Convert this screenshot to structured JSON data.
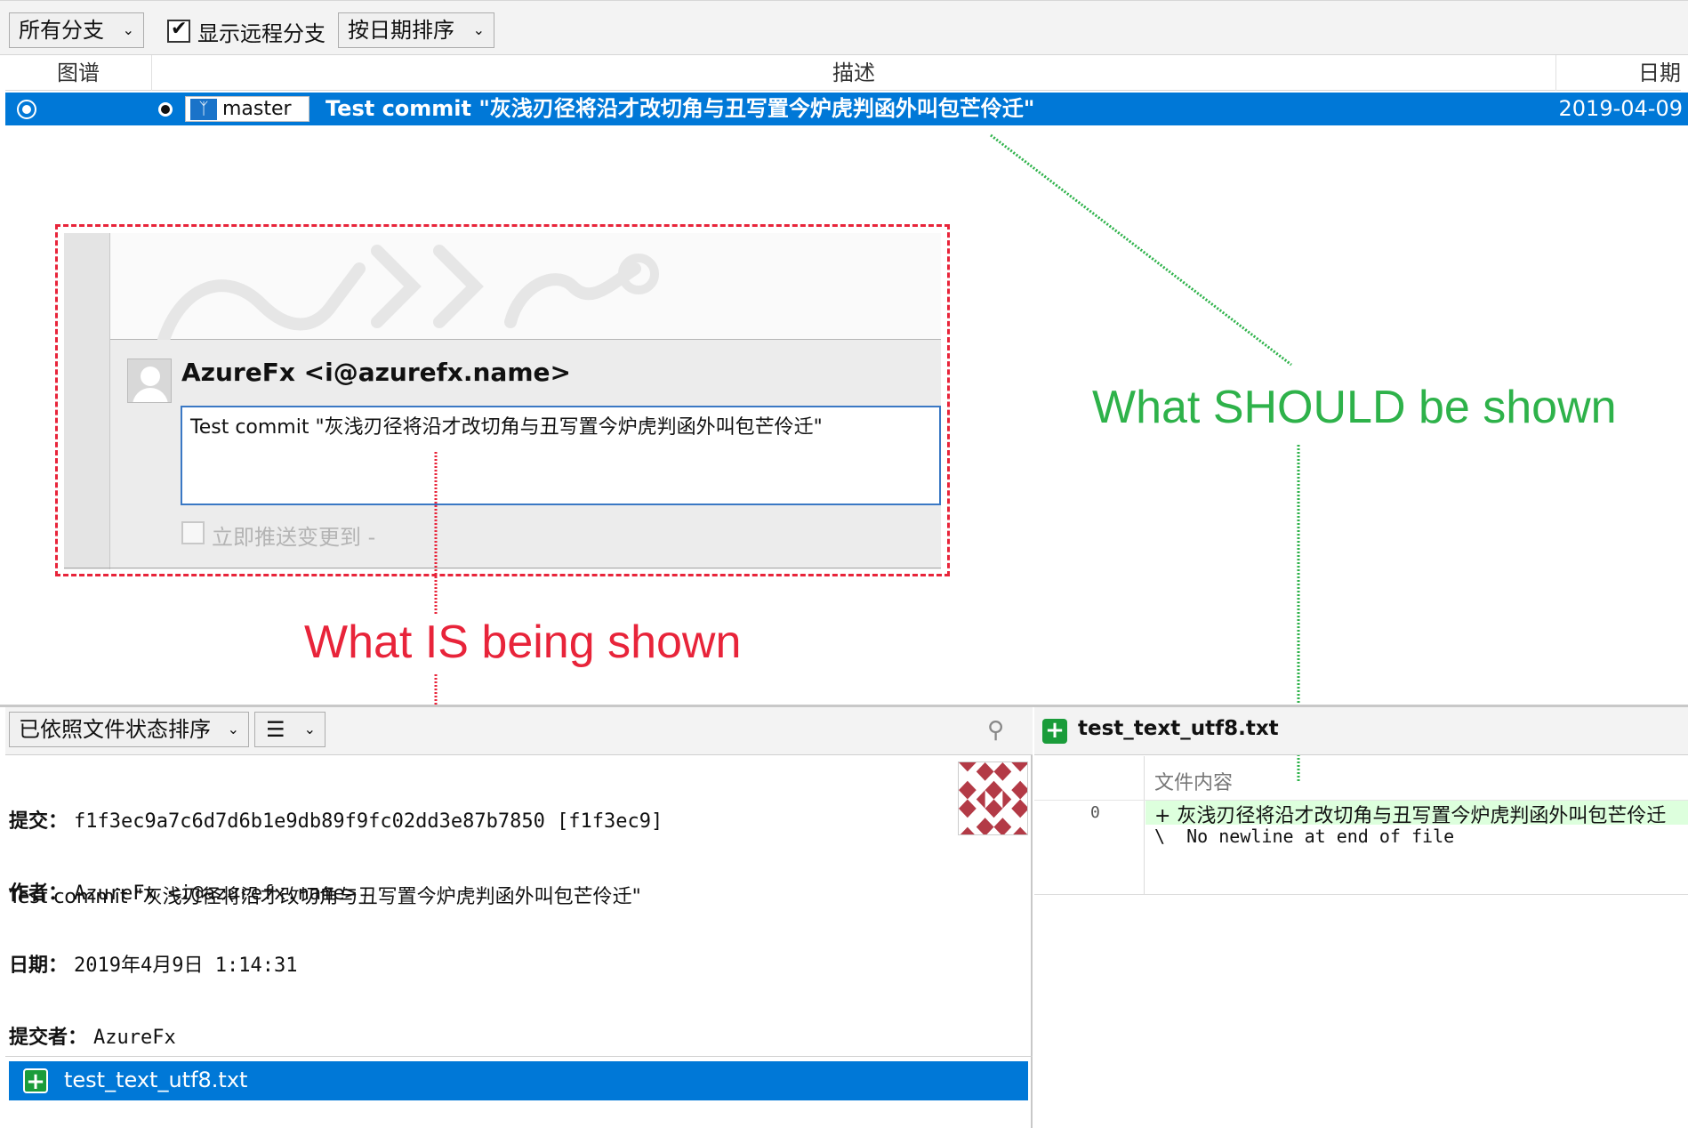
{
  "toolbar": {
    "branch_filter": "所有分支",
    "show_remote_label": "显示远程分支",
    "show_remote_checked": true,
    "sort": "按日期排序"
  },
  "columns": {
    "graph": "图谱",
    "description": "描述",
    "date": "日期"
  },
  "commit_row": {
    "branch": "master",
    "message": "Test commit \"灰浅刃径将沿才改切角与丑写置今炉虎判函外叫包芒伶迁\"",
    "date": "2019-04-09"
  },
  "annotation": {
    "dialog_author": "AzureFx <i@azurefx.name>",
    "dialog_message": "Test commit \"灰浅刃径将沿才改切角与丑写置今炉虎判函外叫包芒伶迁\"",
    "dialog_push_label": "立即推送变更到 -",
    "is_label": "What IS being shown",
    "should_label": "What SHOULD be shown",
    "red_color": "#e8243a",
    "green_color": "#2eb24a"
  },
  "lower_left": {
    "sort_mode": "已依照文件状态排序",
    "info_lines": [
      {
        "label": "提交：",
        "value": "f1f3ec9a7c6d7d6b1e9db89f9fc02dd3e87b7850 [f1f3ec9]"
      },
      {
        "label": "作者：",
        "value": "AzureFx <i@azurefx.name>"
      },
      {
        "label": "日期：",
        "value": "2019年4月9日 1:14:31"
      },
      {
        "label": "提交者：",
        "value": "AzureFx"
      }
    ],
    "message": "Test commit \"灰浅刃径将沿才改切角与丑写置今炉虎判函外叫包芒伶迁\"",
    "file": "test_text_utf8.txt"
  },
  "lower_right": {
    "file": "test_text_utf8.txt",
    "column": "文件内容",
    "line_no": "0",
    "added_line": "+ 灰浅刃径将沿才改切角与丑写置今炉虎判函外叫包芒伶迁",
    "no_newline": "\\  No newline at end of file"
  },
  "accent": "#0078d7"
}
